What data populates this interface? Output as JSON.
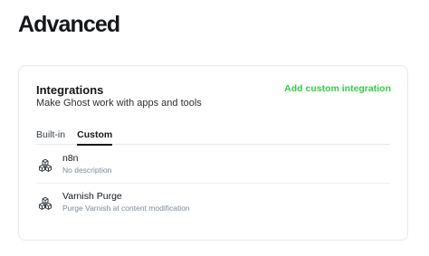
{
  "page": {
    "title": "Advanced"
  },
  "integrations": {
    "title": "Integrations",
    "description": "Make Ghost work with apps and tools",
    "add_label": "Add custom integration",
    "accent_color": "#30cf43",
    "tabs": [
      {
        "label": "Built-in",
        "active": false
      },
      {
        "label": "Custom",
        "active": true
      }
    ],
    "items": [
      {
        "name": "n8n",
        "description": "No description",
        "icon": "cubes-icon"
      },
      {
        "name": "Varnish Purge",
        "description": "Purge Varnish at content modification",
        "icon": "cubes-icon"
      }
    ]
  }
}
